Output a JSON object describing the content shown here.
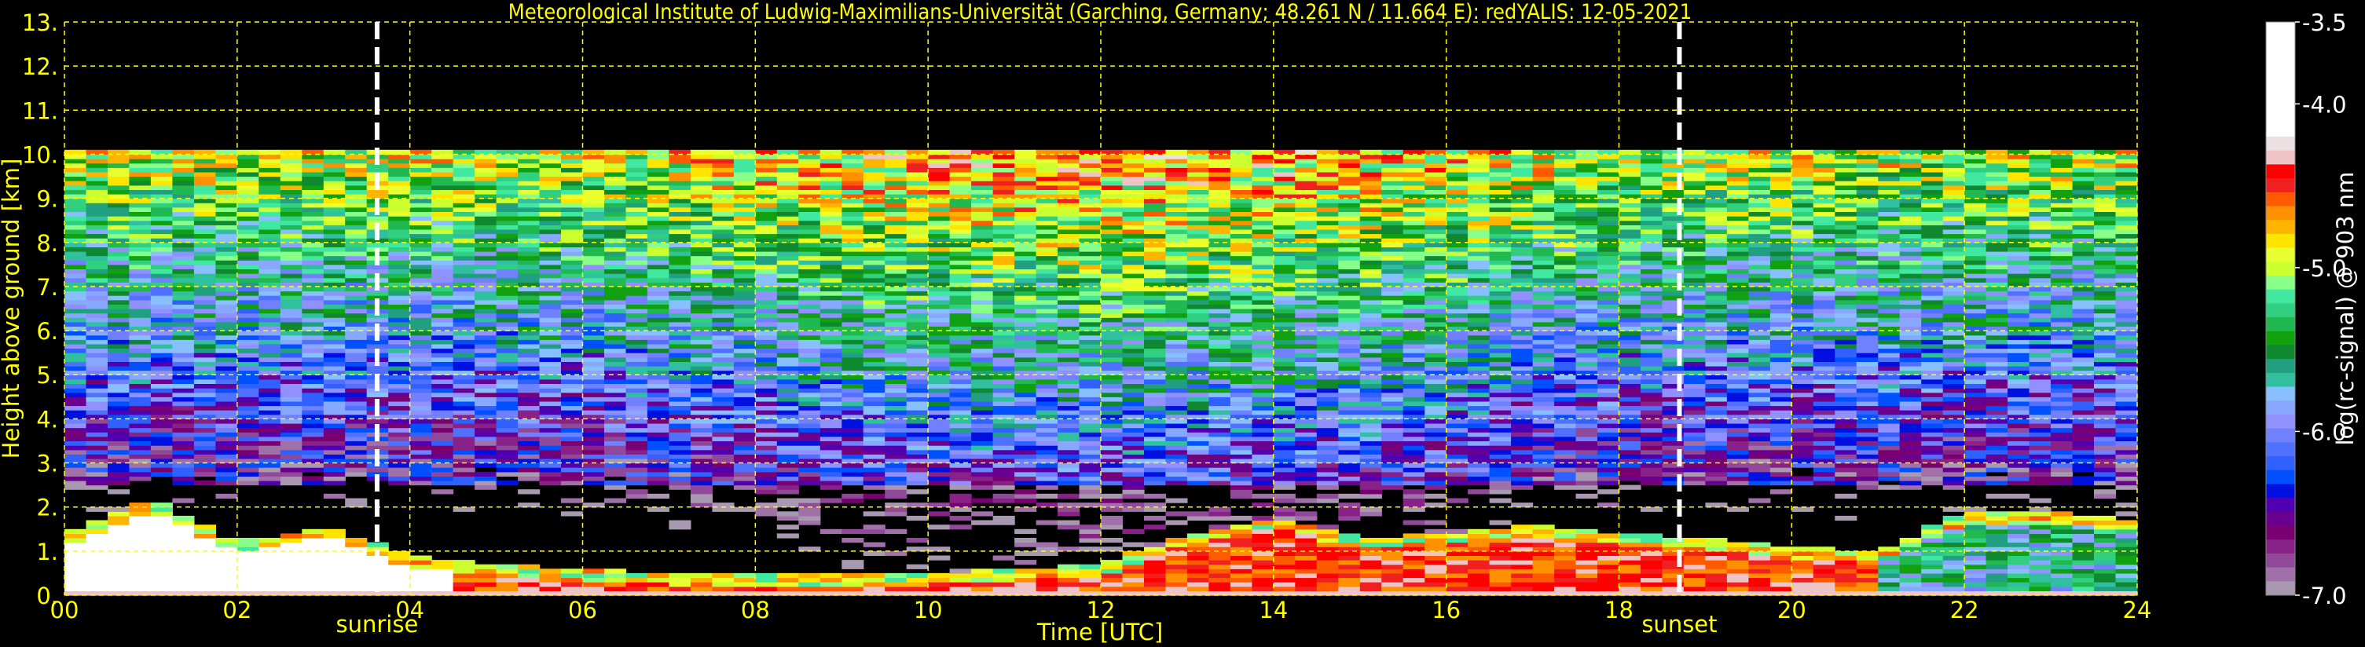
{
  "chart_data": {
    "type": "heatmap",
    "title": "Meteorological Institute of Ludwig-Maximilians-Universität (Garching, Germany; 48.261 N / 11.664 E):    redYALIS: 12-05-2021",
    "xlabel": "Time [UTC]",
    "ylabel": "Height above ground [km]",
    "xlim": [
      0,
      24
    ],
    "ylim": [
      0,
      13
    ],
    "x_ticks": [
      "00",
      "02",
      "04",
      "06",
      "08",
      "10",
      "12",
      "14",
      "16",
      "18",
      "20",
      "22",
      "24"
    ],
    "y_ticks": [
      "0.",
      "1.",
      "2.",
      "3.",
      "4.",
      "5.",
      "6.",
      "7.",
      "8.",
      "9.",
      "10.",
      "11.",
      "12.",
      "13."
    ],
    "grid": true,
    "data_top_km": 10,
    "annotations": [
      {
        "label": "sunrise",
        "time_h": 3.62
      },
      {
        "label": "sunset",
        "time_h": 18.7
      }
    ],
    "boundary_layer_top_km_hourly": [
      1.3,
      2.1,
      1.1,
      1.5,
      0.8,
      0.6,
      0.5,
      0.4,
      0.4,
      0.4,
      0.4,
      0.5,
      0.6,
      1.3,
      1.7,
      1.2,
      1.3,
      1.5,
      1.3,
      1.2,
      1.0,
      0.9,
      1.8,
      1.8,
      1.6
    ],
    "colorbar": {
      "label": "log(rc-signal) @ 903 nm",
      "range": [
        -7.0,
        -3.5
      ],
      "ticks": [
        "-3.5",
        "-4.0",
        "-5.0",
        "-6.0",
        "-7.0"
      ],
      "tick_values": [
        -3.5,
        -4.0,
        -5.0,
        -6.0,
        -7.0
      ],
      "colors": [
        "#ffffff",
        "#ebe0e2",
        "#f0c4c6",
        "#ff0000",
        "#f02020",
        "#ff5a00",
        "#ff9000",
        "#ffb400",
        "#ffe400",
        "#e8ff30",
        "#ccff30",
        "#88ff88",
        "#40e8a0",
        "#30d080",
        "#20b850",
        "#10a010",
        "#108830",
        "#20a080",
        "#30c0a0",
        "#88c0ff",
        "#88a8ff",
        "#9090ff",
        "#7080ff",
        "#5070ff",
        "#3060ff",
        "#0050ff",
        "#0010e0",
        "#5000b0",
        "#6a0090",
        "#780070",
        "#882288",
        "#904898",
        "#a070a8",
        "#a898b0"
      ]
    }
  }
}
